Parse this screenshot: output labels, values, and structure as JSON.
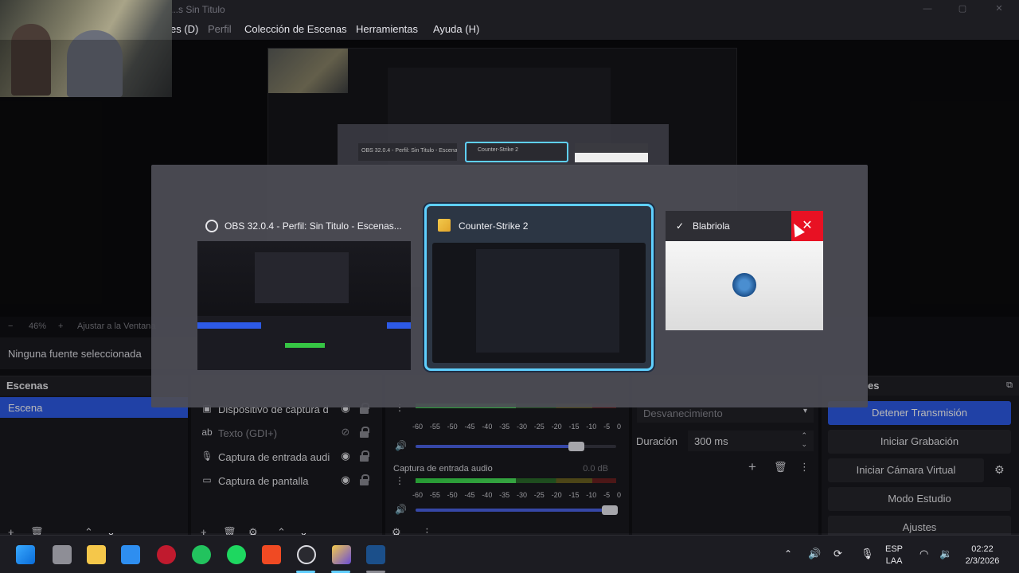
{
  "window": {
    "title": "...s Sin Titulo"
  },
  "menu": [
    {
      "label": "es (D)"
    },
    {
      "label": "Perfil"
    },
    {
      "label": "Colección de Escenas"
    },
    {
      "label": "Herramientas"
    },
    {
      "label": "Ayuda (H)"
    }
  ],
  "zoom": {
    "minus": "−",
    "value": "46%",
    "plus": "+",
    "fit": "Ajustar a la Ventana"
  },
  "no_source": "Ninguna fuente seleccionada",
  "scenes": {
    "header": "Escenas",
    "items": [
      "Escena"
    ]
  },
  "sources": [
    {
      "label": "Dispositivo de captura d",
      "icon": "camera-icon"
    },
    {
      "label": "Texto (GDI+)",
      "icon": "text-icon"
    },
    {
      "label": "Captura de entrada audi",
      "icon": "mic-icon"
    },
    {
      "label": "Captura de pantalla",
      "icon": "monitor-icon"
    }
  ],
  "mixer": {
    "ticks": [
      "-60",
      "-55",
      "-50",
      "-45",
      "-40",
      "-35",
      "-30",
      "-25",
      "-20",
      "-15",
      "-10",
      "-5",
      "0"
    ],
    "channels": [
      {
        "name": "",
        "db": "",
        "level": 0.5,
        "volume": 0.8
      },
      {
        "name": "Captura de entrada audio",
        "db": "0.0 dB",
        "level": 0.5,
        "volume": 0.97
      }
    ]
  },
  "transitions": {
    "type": "Desvanecimiento",
    "duration_label": "Duración",
    "duration_value": "300 ms"
  },
  "controls": {
    "header": "es",
    "buttons": [
      {
        "label": "Detener Transmisión",
        "active": true
      },
      {
        "label": "Iniciar Grabación",
        "active": false
      },
      {
        "label": "Iniciar Cámara Virtual",
        "active": false
      },
      {
        "label": "Modo Estudio",
        "active": false
      },
      {
        "label": "Ajustes",
        "active": false
      }
    ]
  },
  "alttab": {
    "cards": [
      {
        "title": "OBS 32.0.4 - Perfil: Sin Titulo - Escenas...",
        "icon": "obs-icon"
      },
      {
        "title": "Counter-Strike 2",
        "icon": "cs2-icon"
      },
      {
        "title": "Blabriola",
        "icon": "steam-icon"
      }
    ],
    "close": "✕",
    "ghost_cards": [
      "OBS 32.0.4 - Perfil: Sin Titulo - Escenas...",
      "Counter-Strike 2",
      "Blabriola"
    ]
  },
  "taskbar": {
    "apps": [
      "windows-start-icon",
      "file-icon",
      "folder-icon",
      "store-icon",
      "opera-icon",
      "whatsapp-icon",
      "spotify-icon",
      "brave-icon",
      "obs-icon",
      "cs2-icon",
      "steam-icon"
    ],
    "lang_top": "ESP",
    "lang_bottom": "LAA",
    "time": "02:22",
    "date": "2/3/2026"
  },
  "colors": {
    "accent": "#2d5ae6",
    "selection_border": "#5fd0ff",
    "close_red": "#e81123"
  }
}
